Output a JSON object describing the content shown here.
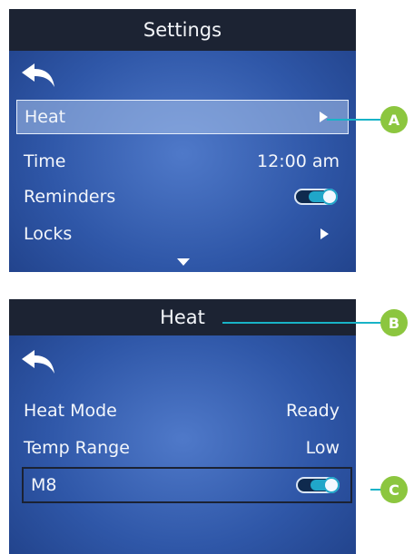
{
  "screen1": {
    "title": "Settings",
    "items": [
      {
        "label": "Heat",
        "value": "",
        "control": "arrow",
        "selected": true
      },
      {
        "label": "Time",
        "value": "12:00 am",
        "control": "text"
      },
      {
        "label": "Reminders",
        "value": "",
        "control": "toggle",
        "state": "on"
      },
      {
        "label": "Locks",
        "value": "",
        "control": "arrow"
      }
    ],
    "icons": {
      "back": "back-arrow-icon",
      "more": "scroll-down-arrow-icon"
    }
  },
  "screen2": {
    "title": "Heat",
    "items": [
      {
        "label": "Heat Mode",
        "value": "Ready"
      },
      {
        "label": "Temp Range",
        "value": "Low"
      },
      {
        "label": "M8",
        "value": "",
        "control": "toggle",
        "state": "on",
        "outlined": true
      }
    ],
    "icons": {
      "back": "back-arrow-icon"
    }
  },
  "callouts": [
    "A",
    "B",
    "C"
  ],
  "colors": {
    "titlebar": "#1c2333",
    "screen_bg": "#2f57a8",
    "accent": "#18b3c7",
    "callout_badge": "#8cc63f"
  }
}
